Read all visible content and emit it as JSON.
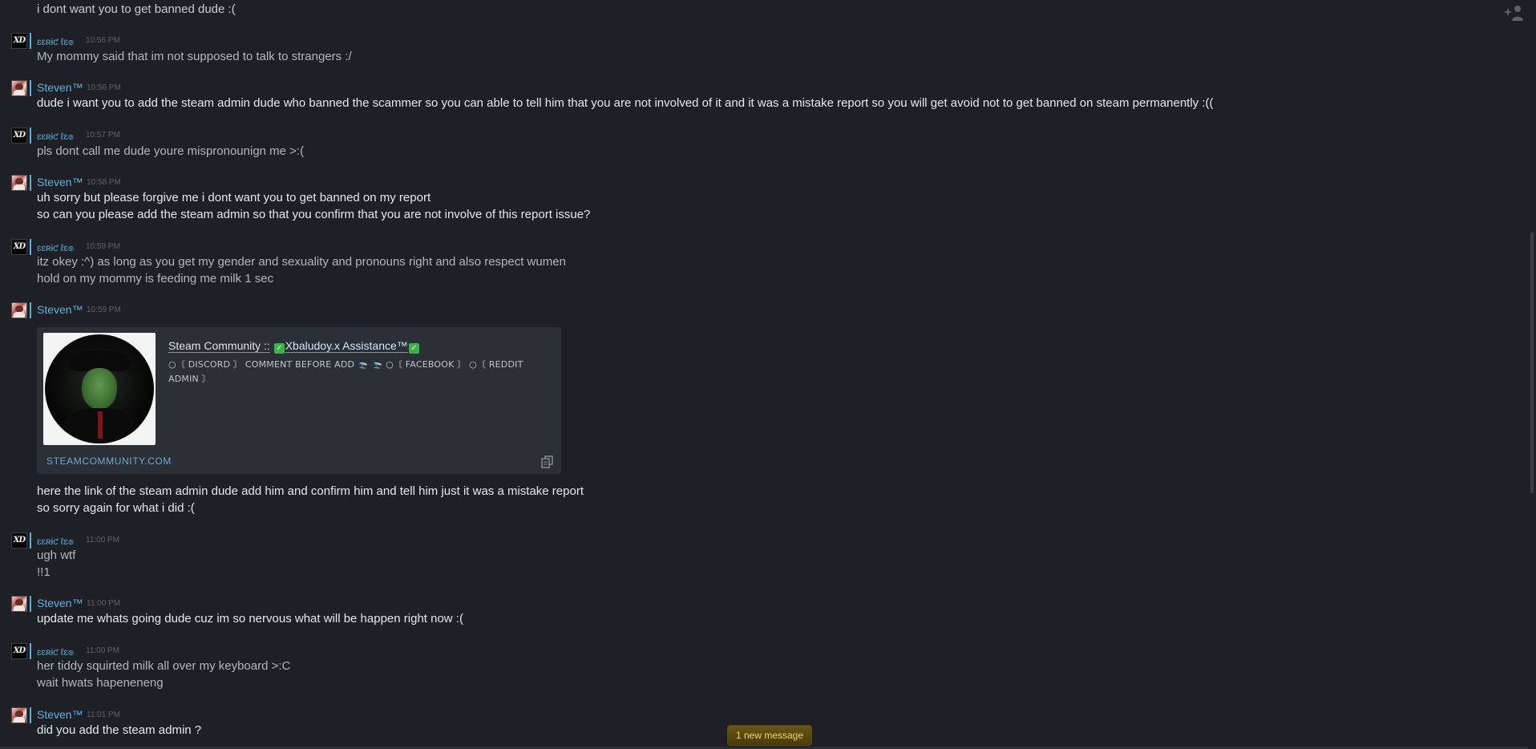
{
  "top_line": "i dont want you to get banned dude :(",
  "messages": [
    {
      "sender": "ɛɛʀɨƈ ℓɛ๏",
      "time": "10:56 PM",
      "lines": [
        "My mommy said that im not supposed to talk to strangers :/"
      ]
    },
    {
      "sender": "Steven™",
      "time": "10:56 PM",
      "lines": [
        "dude i want you to add the steam admin dude who banned the scammer so you can able to tell him that you are not involved of it and it was a mistake report so you will get avoid not to get banned on steam permanently :(("
      ]
    },
    {
      "sender": "ɛɛʀɨƈ ℓɛ๏",
      "time": "10:57 PM",
      "lines": [
        "pls dont call me dude youre mispronounign me >:("
      ]
    },
    {
      "sender": "Steven™",
      "time": "10:58 PM",
      "lines": [
        "uh sorry but please forgive me i dont want you to get banned on my report",
        "so can you please add the steam admin so that you confirm that you are not involve of this report issue?"
      ]
    },
    {
      "sender": "ɛɛʀɨƈ ℓɛ๏",
      "time": "10:59 PM",
      "lines": [
        "itz okey :^) as long as you get my gender and sexuality and pronouns right and also respect wumen",
        "hold on my mommy is feeding me milk 1 sec"
      ]
    },
    {
      "sender": "Steven™",
      "time": "10:59 PM",
      "lines": [
        "here the link of the steam admin dude add him and confirm him and tell him just it was a mistake report",
        "so sorry again for what i did :("
      ]
    },
    {
      "sender": "ɛɛʀɨƈ ℓɛ๏",
      "time": "11:00 PM",
      "lines": [
        "ugh wtf",
        "!!1"
      ]
    },
    {
      "sender": "Steven™",
      "time": "11:00 PM",
      "lines": [
        "update me whats going dude cuz im so nervous what will be happen right now :("
      ]
    },
    {
      "sender": "ɛɛʀɨƈ ℓɛ๏",
      "time": "11:00 PM",
      "lines": [
        "her tiddy squirted milk all over my keyboard >:C",
        "wait hwats hapeneneng"
      ]
    },
    {
      "sender": "Steven™",
      "time": "11:01 PM",
      "lines": [
        "did you add the steam admin ?"
      ]
    }
  ],
  "embed": {
    "site": "Steam Community ::",
    "profile_name": "Xbaludoy.x Assistance™",
    "description": "○〘 DISCORD 〙 COMMENT BEFORE ADD 🛬 🛬 ○〘 FACEBOOK 〙 ○〘 REDDIT ADMIN 〙",
    "url": "STEAMCOMMUNITY.COM"
  },
  "new_message_label": "1 new message"
}
